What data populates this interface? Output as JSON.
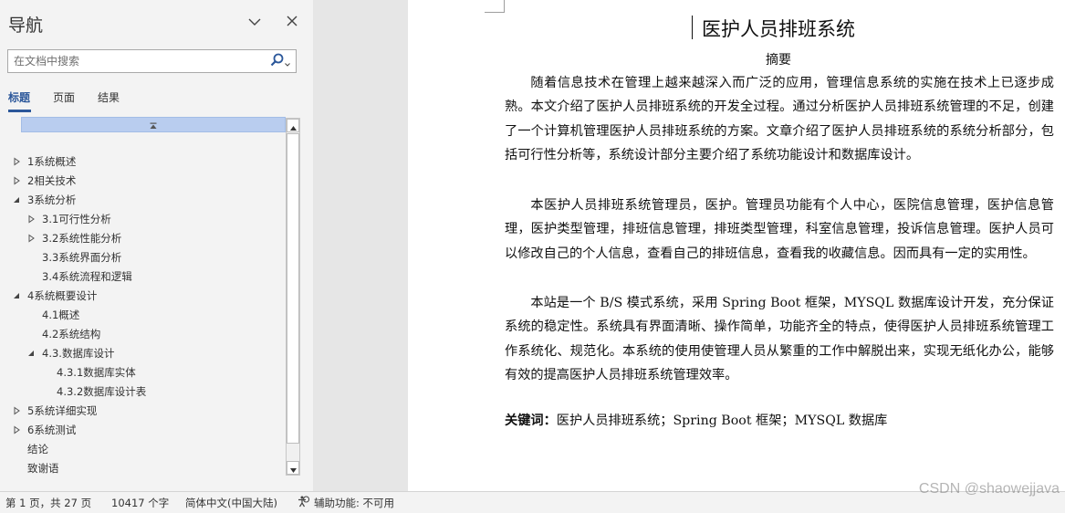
{
  "nav": {
    "title": "导航",
    "search_placeholder": "在文档中搜索",
    "tabs": [
      {
        "label": "标题"
      },
      {
        "label": "页面"
      },
      {
        "label": "结果"
      }
    ],
    "tree": [
      {
        "label": "1系统概述",
        "level": 1,
        "expanded": false,
        "has_children": true
      },
      {
        "label": "2相关技术",
        "level": 1,
        "expanded": false,
        "has_children": true
      },
      {
        "label": "3系统分析",
        "level": 1,
        "expanded": true,
        "has_children": true
      },
      {
        "label": "3.1可行性分析",
        "level": 2,
        "expanded": false,
        "has_children": true
      },
      {
        "label": "3.2系统性能分析",
        "level": 2,
        "expanded": false,
        "has_children": true
      },
      {
        "label": "3.3系统界面分析",
        "level": 2,
        "expanded": false,
        "has_children": false
      },
      {
        "label": "3.4系统流程和逻辑",
        "level": 2,
        "expanded": false,
        "has_children": false
      },
      {
        "label": "4系统概要设计",
        "level": 1,
        "expanded": true,
        "has_children": true
      },
      {
        "label": "4.1概述",
        "level": 2,
        "expanded": false,
        "has_children": false
      },
      {
        "label": "4.2系统结构",
        "level": 2,
        "expanded": false,
        "has_children": false
      },
      {
        "label": "4.3.数据库设计",
        "level": 2,
        "expanded": true,
        "has_children": true
      },
      {
        "label": "4.3.1数据库实体",
        "level": 3,
        "expanded": false,
        "has_children": false
      },
      {
        "label": "4.3.2数据库设计表",
        "level": 3,
        "expanded": false,
        "has_children": false
      },
      {
        "label": "5系统详细实现",
        "level": 1,
        "expanded": false,
        "has_children": true
      },
      {
        "label": "6系统测试",
        "level": 1,
        "expanded": false,
        "has_children": true
      },
      {
        "label": "结论",
        "level": 1,
        "expanded": false,
        "has_children": false
      },
      {
        "label": "致谢语",
        "level": 1,
        "expanded": false,
        "has_children": false
      }
    ]
  },
  "document": {
    "title": "医护人员排班系统",
    "abstract_heading": "摘要",
    "paragraphs": [
      "随着信息技术在管理上越来越深入而广泛的应用，管理信息系统的实施在技术上已逐步成熟。本文介绍了医护人员排班系统的开发全过程。通过分析医护人员排班系统管理的不足，创建了一个计算机管理医护人员排班系统的方案。文章介绍了医护人员排班系统的系统分析部分，包括可行性分析等，系统设计部分主要介绍了系统功能设计和数据库设计。",
      "本医护人员排班系统管理员，医护。管理员功能有个人中心，医院信息管理，医护信息管理，医护类型管理，排班信息管理，排班类型管理，科室信息管理，投诉信息管理。医护人员可以修改自己的个人信息，查看自己的排班信息，查看我的收藏信息。因而具有一定的实用性。",
      "本站是一个 B/S 模式系统，采用 Spring Boot 框架，MYSQL 数据库设计开发，充分保证系统的稳定性。系统具有界面清晰、操作简单，功能齐全的特点，使得医护人员排班系统管理工作系统化、规范化。本系统的使用使管理人员从繁重的工作中解脱出来，实现无纸化办公，能够有效的提高医护人员排班系统管理效率。"
    ],
    "keywords_label": "关键词：",
    "keywords": "医护人员排班系统；Spring Boot 框架；MYSQL 数据库"
  },
  "status": {
    "page": "第 1 页，共 27 页",
    "words": "10417 个字",
    "language": "简体中文(中国大陆)",
    "accessibility": "辅助功能: 不可用"
  },
  "watermark": "CSDN @shaowejjava",
  "colors": {
    "accent": "#2b579a",
    "collapse_bar": "#b9cdef"
  }
}
